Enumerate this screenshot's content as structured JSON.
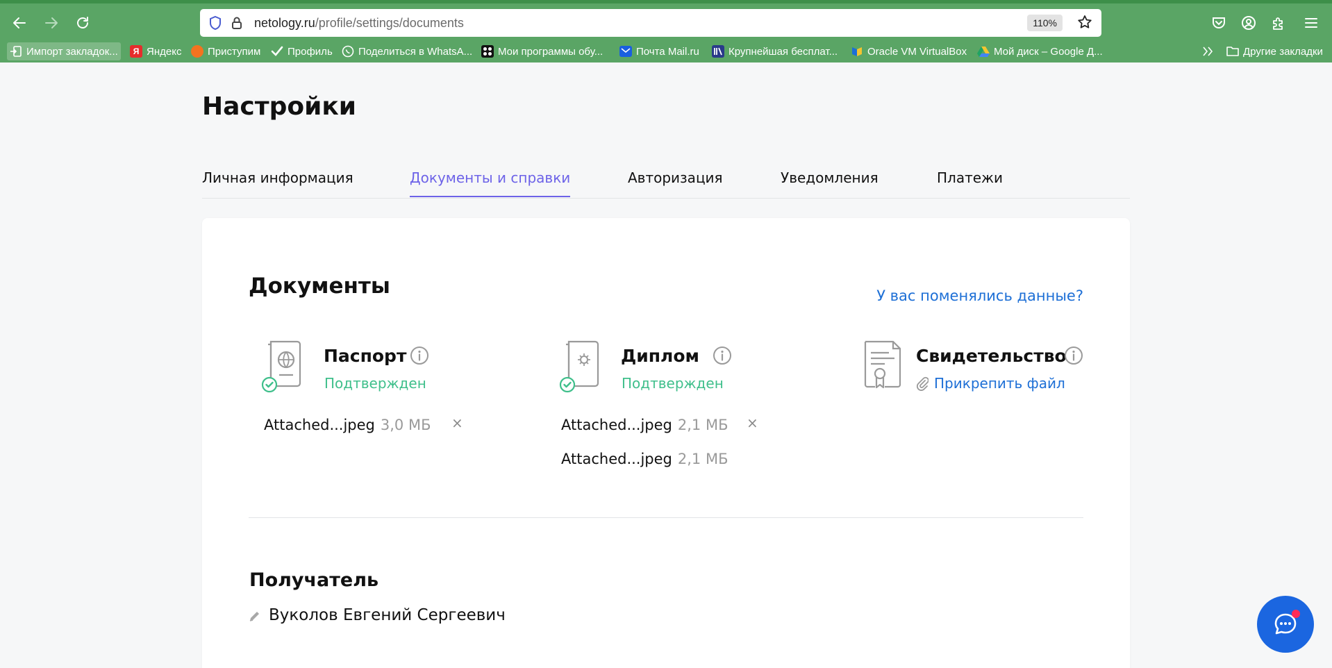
{
  "browser": {
    "url_domain": "netology.ru",
    "url_path": "/profile/settings/documents",
    "zoom": "110%",
    "bookmarks": [
      {
        "label": "Импорт закладок..."
      },
      {
        "label": "Яндекс"
      },
      {
        "label": "Приступим"
      },
      {
        "label": "Профиль"
      },
      {
        "label": "Поделиться в WhatsA..."
      },
      {
        "label": "Мои программы обу..."
      },
      {
        "label": "Почта Mail.ru"
      },
      {
        "label": "Крупнейшая бесплат..."
      },
      {
        "label": "Oracle VM VirtualBox"
      },
      {
        "label": "Мой диск – Google Д..."
      }
    ],
    "other_bookmarks": "Другие закладки",
    "yandex_glyph": "Я"
  },
  "page": {
    "title": "Настройки",
    "tabs": [
      {
        "label": "Личная информация"
      },
      {
        "label": "Документы и справки"
      },
      {
        "label": "Авторизация"
      },
      {
        "label": "Уведомления"
      },
      {
        "label": "Платежи"
      }
    ]
  },
  "documents": {
    "title": "Документы",
    "changed_link": "У вас поменялись данные?",
    "passport": {
      "title": "Паспорт",
      "status": "Подтвержден",
      "files": [
        {
          "name": "Attached...jpeg",
          "size": "3,0 МБ",
          "remove": "×"
        }
      ]
    },
    "diploma": {
      "title": "Диплом",
      "status": "Подтвержден",
      "files": [
        {
          "name": "Attached...jpeg",
          "size": "2,1 МБ",
          "remove": "×"
        },
        {
          "name": "Attached...jpeg",
          "size": "2,1 МБ"
        }
      ]
    },
    "certificate": {
      "title": "Свидетельство",
      "attach_label": "Прикрепить файл"
    }
  },
  "recipient": {
    "title": "Получатель",
    "name": "Вуколов Евгений Сергеевич"
  },
  "colors": {
    "chrome_green": "#5aa565",
    "accent_purple": "#6d63e8",
    "link_blue": "#1d6fd6",
    "status_green": "#3fbf8b",
    "chat_blue": "#1b66e0"
  }
}
